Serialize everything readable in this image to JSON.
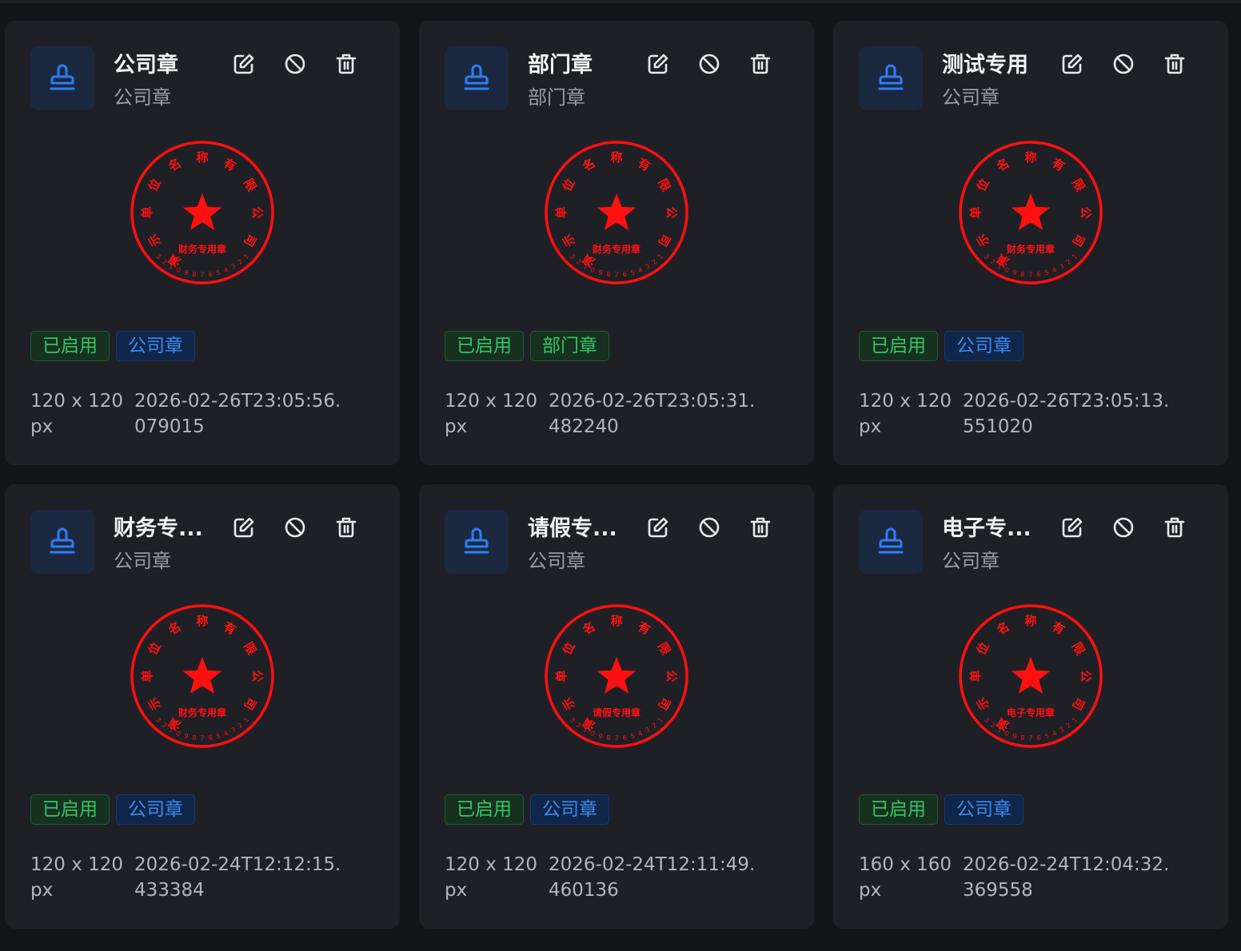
{
  "colors": {
    "background": "#141519",
    "card": "#1f2026",
    "seal_red": "#ff1010",
    "icon_blue": "#2f7df6",
    "tag_green": "#37c465",
    "tag_blue": "#3c8cf0"
  },
  "icons": {
    "avatar": "stamp-icon",
    "edit": "edit-icon",
    "disable": "ban-icon",
    "delete": "trash-icon"
  },
  "seal": {
    "arc_text": [
      "演",
      "示",
      "单",
      "位",
      "名",
      "称",
      "有",
      "限",
      "公",
      "司"
    ],
    "number": "1234567890123"
  },
  "cards": [
    {
      "title": "公司章",
      "subtitle": "公司章",
      "seal_label": "财务专用章",
      "status": "已启用",
      "type_tag": "公司章",
      "type_tag_color": "blue",
      "size": "120 x 120 px",
      "created": "2026-02-26T23:05:56.079015"
    },
    {
      "title": "部门章",
      "subtitle": "部门章",
      "seal_label": "财务专用章",
      "status": "已启用",
      "type_tag": "部门章",
      "type_tag_color": "green",
      "size": "120 x 120 px",
      "created": "2026-02-26T23:05:31.482240"
    },
    {
      "title": "测试专用",
      "subtitle": "公司章",
      "seal_label": "财务专用章",
      "status": "已启用",
      "type_tag": "公司章",
      "type_tag_color": "blue",
      "size": "120 x 120 px",
      "created": "2026-02-26T23:05:13.551020"
    },
    {
      "title": "财务专...",
      "subtitle": "公司章",
      "seal_label": "财务专用章",
      "status": "已启用",
      "type_tag": "公司章",
      "type_tag_color": "blue",
      "size": "120 x 120 px",
      "created": "2026-02-24T12:12:15.433384"
    },
    {
      "title": "请假专...",
      "subtitle": "公司章",
      "seal_label": "请假专用章",
      "status": "已启用",
      "type_tag": "公司章",
      "type_tag_color": "blue",
      "size": "120 x 120 px",
      "created": "2026-02-24T12:11:49.460136"
    },
    {
      "title": "电子专...",
      "subtitle": "公司章",
      "seal_label": "电子专用章",
      "status": "已启用",
      "type_tag": "公司章",
      "type_tag_color": "blue",
      "size": "160 x 160 px",
      "created": "2026-02-24T12:04:32.369558"
    }
  ]
}
